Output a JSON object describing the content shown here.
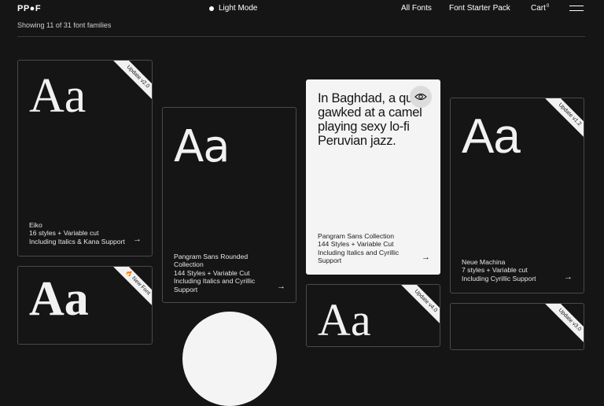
{
  "header": {
    "logo": "PP●F",
    "mode_label": "Light Mode",
    "nav": {
      "all_fonts": "All Fonts",
      "starter_pack": "Font Starter Pack",
      "cart": "Cart",
      "cart_count": "0"
    }
  },
  "results_text": "Showing 11 of 31 font families",
  "cards": {
    "eiko": {
      "specimen": "Aa",
      "ribbon": "Update v2.0",
      "name": "Eiko",
      "styles": "16 styles + Variable cut",
      "support": "Including Italics & Kana Support",
      "arrow": "→"
    },
    "pangram_rounded": {
      "specimen": "Aa",
      "name": "Pangram Sans Rounded Collection",
      "styles": "144 Styles + Variable Cut",
      "support": "Including Italics and Cyrillic Support",
      "arrow": "→"
    },
    "pangram_sans": {
      "pangram": "In Baghdad, a quail gawked at a camel playing sexy lo-fi Peruvian jazz.",
      "name": "Pangram Sans Collection",
      "styles": "144 Styles + Variable Cut",
      "support": "Including Italics and Cyrillic Support",
      "arrow": "→"
    },
    "neue_machina": {
      "specimen": "Aa",
      "ribbon": "Update v1.2",
      "name": "Neue Machina",
      "styles": "7 styles + Variable cut",
      "support": "Including Cyrillic Support",
      "arrow": "→"
    },
    "new_font": {
      "specimen": "Aa",
      "ribbon": "New Font",
      "ribbon_icon": "🔥"
    },
    "update_v4": {
      "specimen": "Aa",
      "ribbon": "Update v4.0"
    },
    "update_v3": {
      "ribbon": "Update v3.0"
    }
  }
}
